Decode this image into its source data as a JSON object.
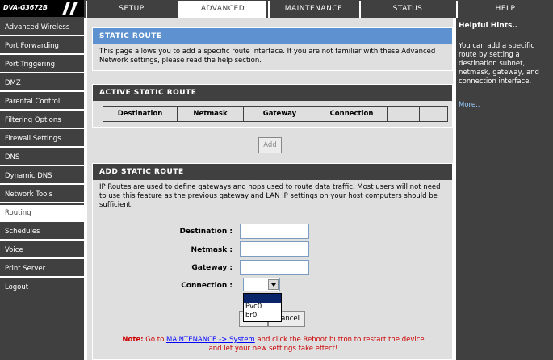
{
  "brand": {
    "model": "DVA-G3672B"
  },
  "tabs": [
    {
      "label": "SETUP"
    },
    {
      "label": "ADVANCED"
    },
    {
      "label": "MAINTENANCE"
    },
    {
      "label": "STATUS"
    },
    {
      "label": "HELP"
    }
  ],
  "sidebar": {
    "items": [
      {
        "label": "Advanced Wireless"
      },
      {
        "label": "Port Forwarding"
      },
      {
        "label": "Port Triggering"
      },
      {
        "label": "DMZ"
      },
      {
        "label": "Parental Control"
      },
      {
        "label": "Filtering Options"
      },
      {
        "label": "Firewall Settings"
      },
      {
        "label": "DNS"
      },
      {
        "label": "Dynamic DNS"
      },
      {
        "label": "Network Tools"
      },
      {
        "label": "Routing"
      },
      {
        "label": "Schedules"
      },
      {
        "label": "Voice"
      },
      {
        "label": "Print Server"
      },
      {
        "label": "Logout"
      }
    ]
  },
  "static_route": {
    "title": "STATIC ROUTE",
    "description": "This page allows you to add a specific route interface. If you are not familiar with these Advanced Network settings, please read the help section."
  },
  "active_static_route": {
    "title": "ACTIVE STATIC ROUTE",
    "columns": [
      "Destination",
      "Netmask",
      "Gateway",
      "Connection",
      "",
      ""
    ],
    "add_label": "Add"
  },
  "add_static_route": {
    "title": "ADD STATIC ROUTE",
    "description": "IP Routes are used to define gateways and hops used to route data traffic. Most users will not need to use this feature as the previous gateway and LAN IP settings on your host computers should be sufficient.",
    "fields": {
      "destination_label": "Destination :",
      "destination_value": "",
      "netmask_label": "Netmask :",
      "netmask_value": "",
      "gateway_label": "Gateway :",
      "gateway_value": "",
      "connection_label": "Connection :",
      "connection_value": ""
    },
    "connection_options": [
      "",
      "Pvc0",
      "br0"
    ],
    "apply_label": "",
    "cancel_label": "Cancel",
    "cancel_visible_text": "ancel"
  },
  "note": {
    "prefix": "Note:",
    "text_before": " Go to ",
    "link": "MAINTENANCE -> System",
    "text_after": " and click the Reboot button to restart the device",
    "line2": "and let your new settings take effect!"
  },
  "help": {
    "title": "Helpful Hints..",
    "text": "You can add a specific route by setting a destination subnet, netmask, gateway, and connection interface.",
    "more": "More.."
  }
}
